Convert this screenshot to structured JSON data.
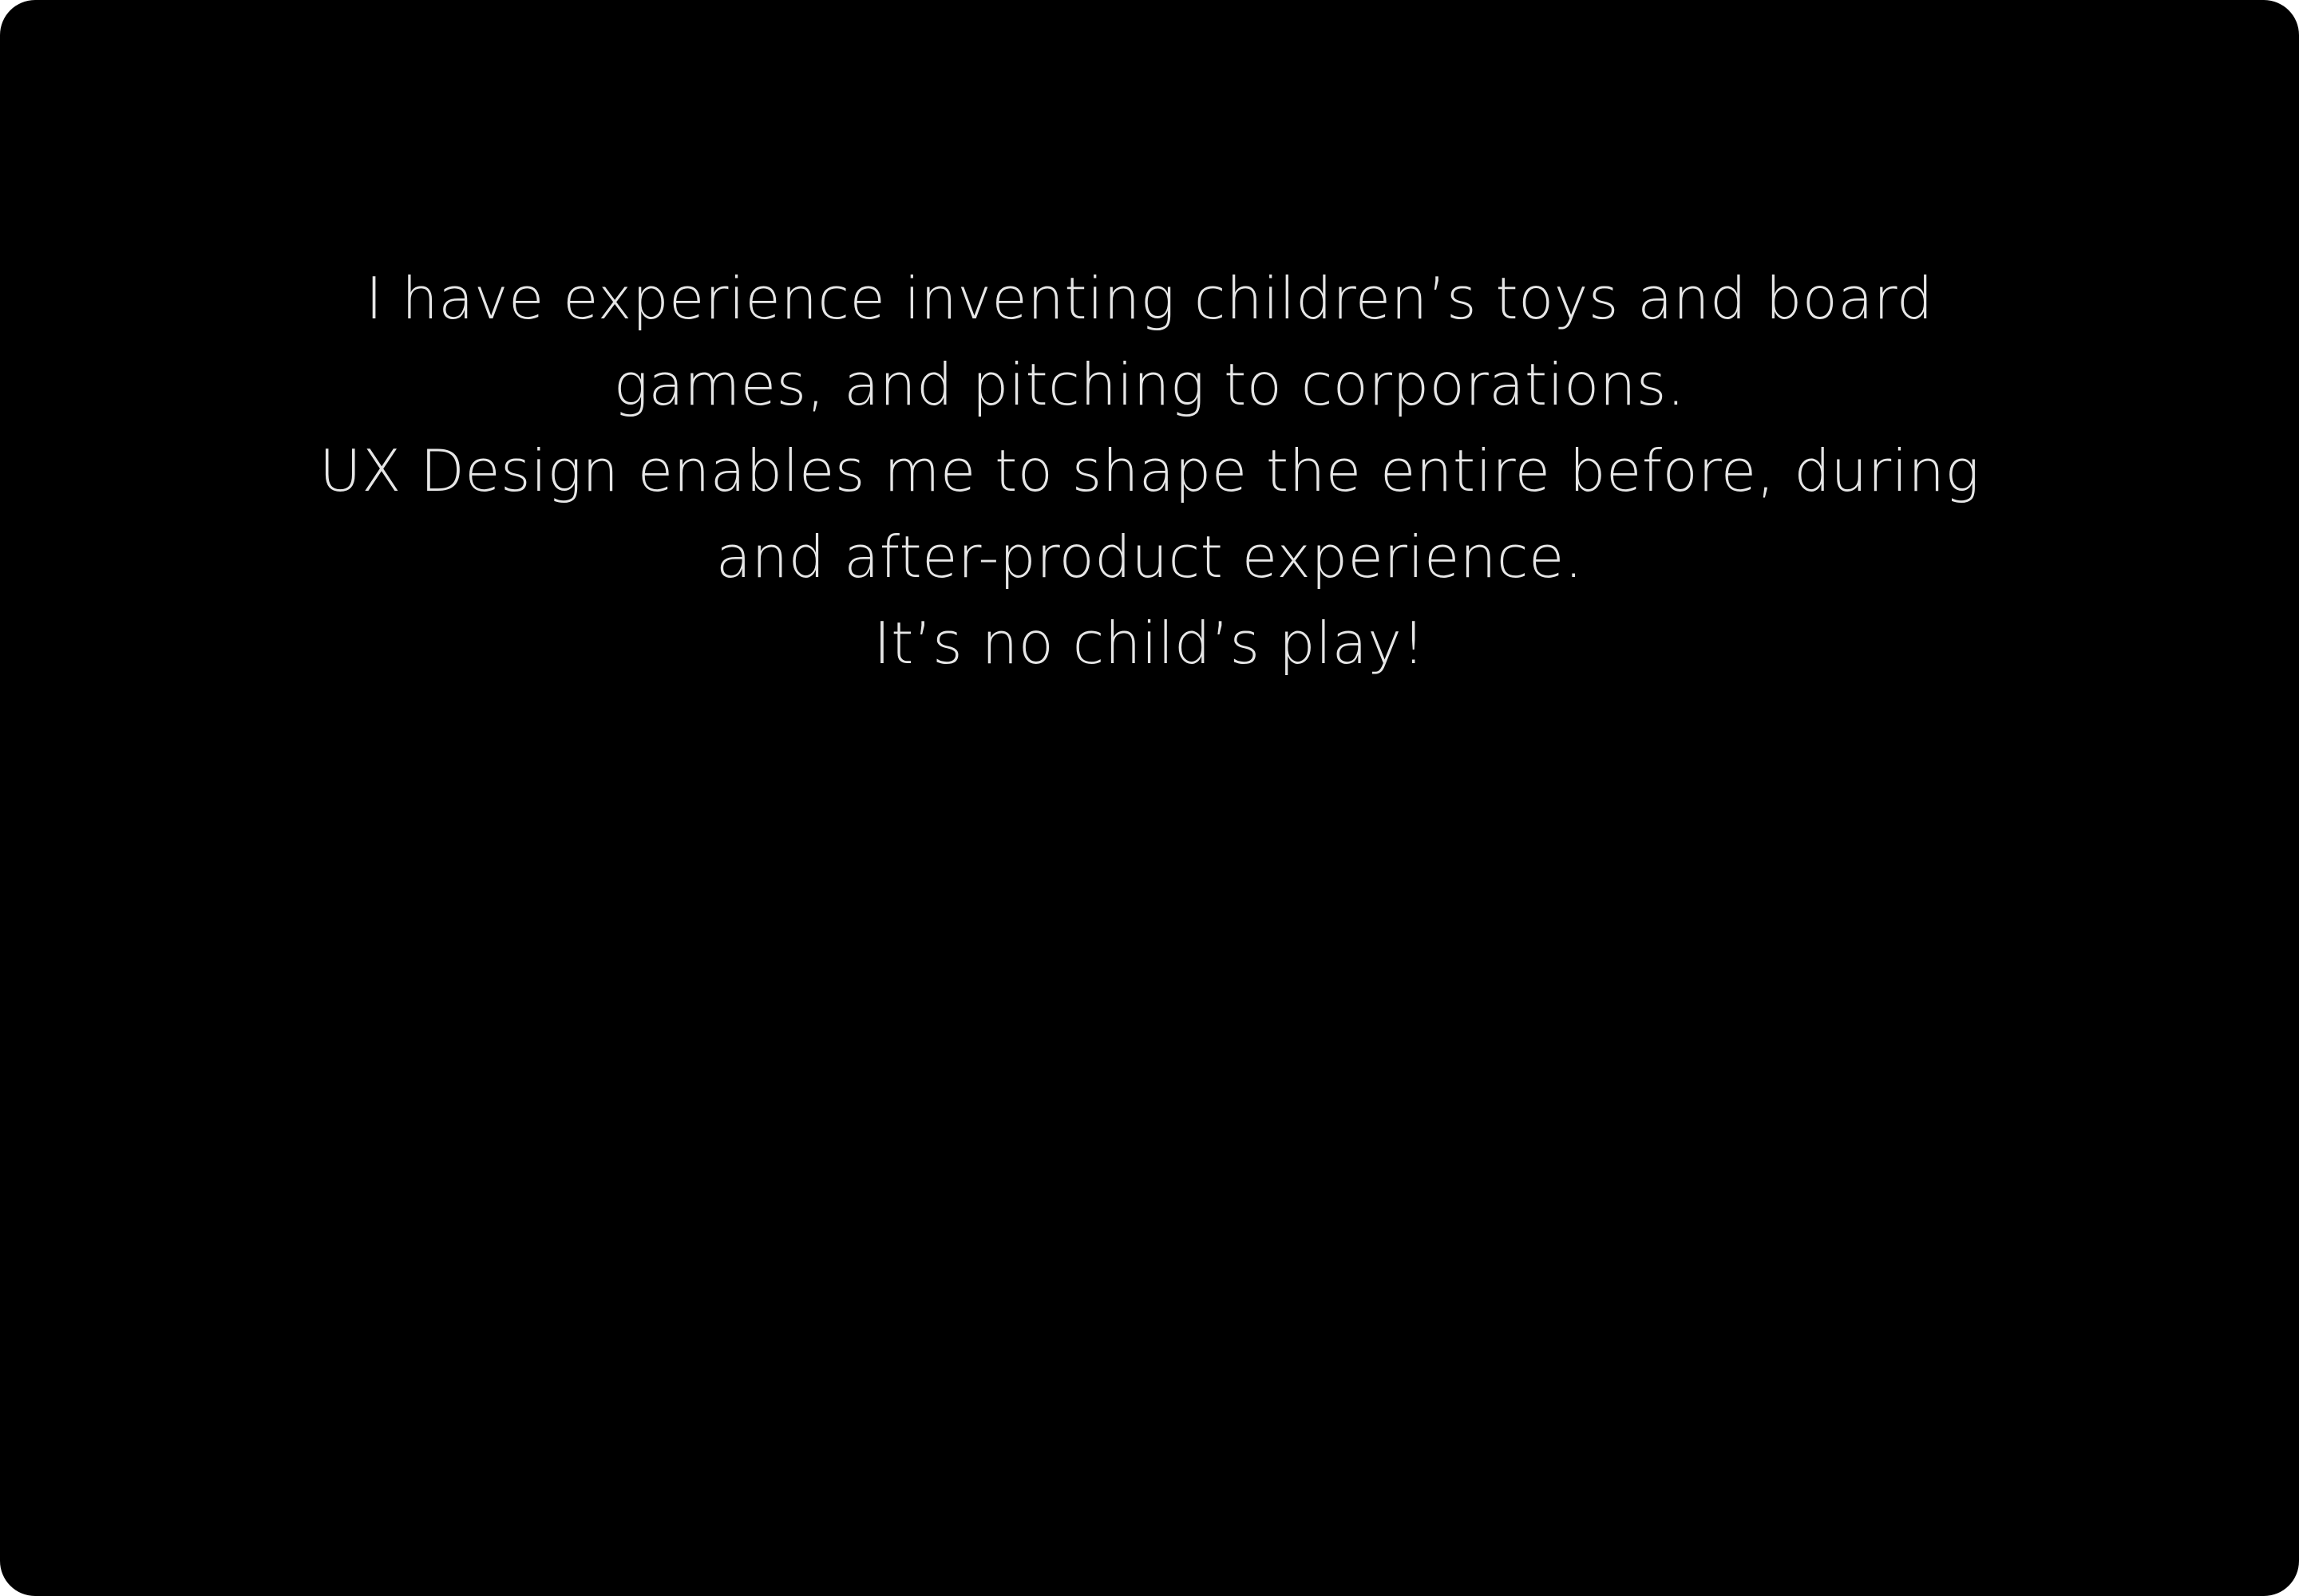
{
  "colors": {
    "background": "#000000",
    "text": "#e6e6e6"
  },
  "statement": {
    "lines": [
      "I have experience inventing children’s toys and board",
      "games, and pitching to corporations.",
      "UX Design enables me to shape the entire before, during",
      "and after-product experience.",
      "It’s no child’s play!"
    ]
  }
}
